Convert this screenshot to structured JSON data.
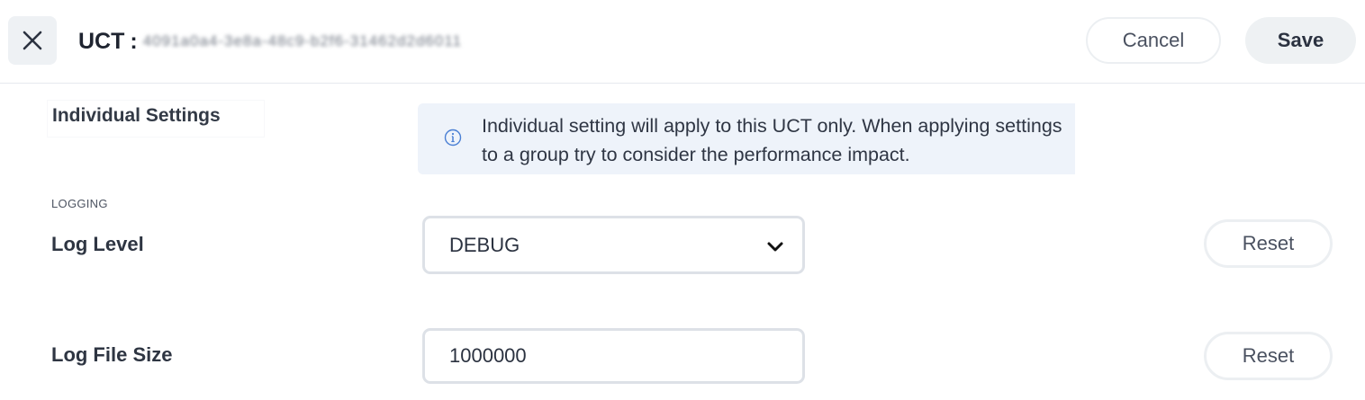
{
  "header": {
    "title_label": "UCT",
    "title_separator": ":",
    "title_id": "4091a0a4-3e8a-48c9-b2f6-31462d2d6011",
    "close_icon": "close-icon",
    "cancel_label": "Cancel",
    "save_label": "Save"
  },
  "section": {
    "title": "Individual Settings"
  },
  "info": {
    "icon": "info-icon",
    "text": "Individual setting will apply to this UCT only. When applying settings to a group try to consider the performance impact."
  },
  "logging": {
    "group_label": "LOGGING",
    "log_level": {
      "label": "Log Level",
      "value": "DEBUG",
      "icon": "chevron-down-icon",
      "reset_label": "Reset"
    },
    "log_file_size": {
      "label": "Log File Size",
      "value": "1000000",
      "reset_label": "Reset"
    }
  },
  "colors": {
    "info_background": "#eef3fa",
    "info_icon": "#4a7fd4",
    "button_background": "#eef1f3",
    "border": "#dde1e7"
  }
}
